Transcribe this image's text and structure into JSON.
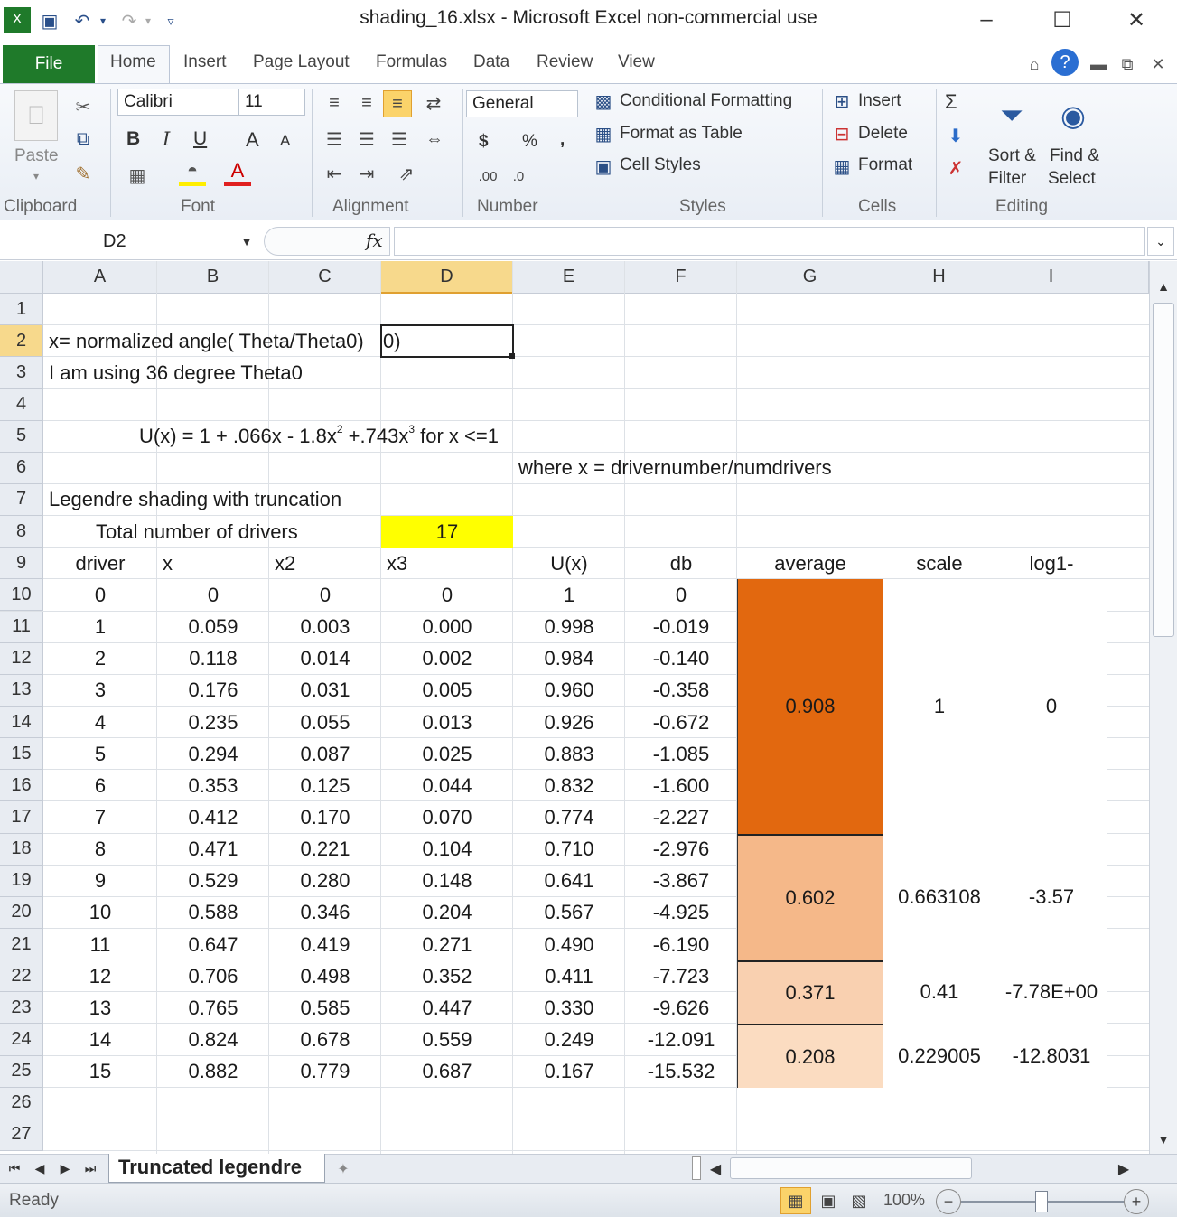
{
  "window": {
    "title": "shading_16.xlsx  -  Microsoft Excel non-commercial use"
  },
  "tabs": [
    "File",
    "Home",
    "Insert",
    "Page Layout",
    "Formulas",
    "Data",
    "Review",
    "View"
  ],
  "ribbon": {
    "clipboard": {
      "paste": "Paste",
      "label": "Clipboard"
    },
    "font": {
      "name": "Calibri",
      "size": "11",
      "label": "Font",
      "bold": "B",
      "italic": "I",
      "underline": "U",
      "grow": "A",
      "shrink": "A"
    },
    "alignment": {
      "label": "Alignment"
    },
    "number": {
      "format": "General",
      "label": "Number",
      "currency": "$",
      "percent": "%",
      "comma": ","
    },
    "styles": {
      "conditional": "Conditional Formatting",
      "format_table": "Format as Table",
      "cell_styles": "Cell Styles",
      "label": "Styles"
    },
    "cells": {
      "insert": "Insert",
      "delete": "Delete",
      "format": "Format",
      "label": "Cells"
    },
    "editing": {
      "sort1": "Sort &",
      "sort2": "Filter",
      "find1": "Find &",
      "find2": "Select",
      "sigma": "Σ",
      "label": "Editing"
    }
  },
  "formula_bar": {
    "name_box": "D2",
    "fx": "fx",
    "formula": ""
  },
  "columns": [
    "A",
    "B",
    "C",
    "D",
    "E",
    "F",
    "G",
    "H",
    "I"
  ],
  "rows": [
    "1",
    "2",
    "3",
    "4",
    "5",
    "6",
    "7",
    "8",
    "9",
    "10",
    "11",
    "12",
    "13",
    "14",
    "15",
    "16",
    "17",
    "18",
    "19",
    "20",
    "21",
    "22",
    "23",
    "24",
    "25",
    "26",
    "27"
  ],
  "text": {
    "a2": "x= normalized angle( Theta/Theta0)",
    "a2_tail": "0)",
    "a3": "I am using 36 degree Theta0",
    "b5": "U(x) = 1 + .066x - 1.8x",
    "b5_sup1": "2",
    "b5_mid": " +.743x",
    "b5_sup2": "3",
    "b5_end": " for x <=1",
    "e6": "where x = drivernumber/numdrivers",
    "a7": "Legendre shading with truncation",
    "a8": "Total number of drivers",
    "d8": "17"
  },
  "table_headers": [
    "driver",
    "x",
    "x2",
    "x3",
    "U(x)",
    "db",
    "average",
    "scale",
    "log1-"
  ],
  "table_rows": [
    [
      "0",
      "0",
      "0",
      "0",
      "1",
      "0"
    ],
    [
      "1",
      "0.059",
      "0.003",
      "0.000",
      "0.998",
      "-0.019"
    ],
    [
      "2",
      "0.118",
      "0.014",
      "0.002",
      "0.984",
      "-0.140"
    ],
    [
      "3",
      "0.176",
      "0.031",
      "0.005",
      "0.960",
      "-0.358"
    ],
    [
      "4",
      "0.235",
      "0.055",
      "0.013",
      "0.926",
      "-0.672"
    ],
    [
      "5",
      "0.294",
      "0.087",
      "0.025",
      "0.883",
      "-1.085"
    ],
    [
      "6",
      "0.353",
      "0.125",
      "0.044",
      "0.832",
      "-1.600"
    ],
    [
      "7",
      "0.412",
      "0.170",
      "0.070",
      "0.774",
      "-2.227"
    ],
    [
      "8",
      "0.471",
      "0.221",
      "0.104",
      "0.710",
      "-2.976"
    ],
    [
      "9",
      "0.529",
      "0.280",
      "0.148",
      "0.641",
      "-3.867"
    ],
    [
      "10",
      "0.588",
      "0.346",
      "0.204",
      "0.567",
      "-4.925"
    ],
    [
      "11",
      "0.647",
      "0.419",
      "0.271",
      "0.490",
      "-6.190"
    ],
    [
      "12",
      "0.706",
      "0.498",
      "0.352",
      "0.411",
      "-7.723"
    ],
    [
      "13",
      "0.765",
      "0.585",
      "0.447",
      "0.330",
      "-9.626"
    ],
    [
      "14",
      "0.824",
      "0.678",
      "0.559",
      "0.249",
      "-12.091"
    ],
    [
      "15",
      "0.882",
      "0.779",
      "0.687",
      "0.167",
      "-15.532"
    ]
  ],
  "merged": [
    {
      "average": "0.908",
      "scale": "1",
      "log": "0",
      "color": "#e2680f"
    },
    {
      "average": "0.602",
      "scale": "0.663108",
      "log": "-3.57",
      "color": "#f5b889"
    },
    {
      "average": "0.371",
      "scale": "0.41",
      "log": "-7.78E+00",
      "color": "#f9d0b0"
    },
    {
      "average": "0.208",
      "scale": "0.229005",
      "log": "-12.8031",
      "color": "#fbdcc1"
    }
  ],
  "sheet_tab": "Truncated legendre",
  "status": {
    "ready": "Ready",
    "zoom": "100%"
  },
  "colors": {
    "highlight": "#ffff00",
    "file_tab": "#1f7a2a",
    "selected_header": "#f7d98c"
  }
}
